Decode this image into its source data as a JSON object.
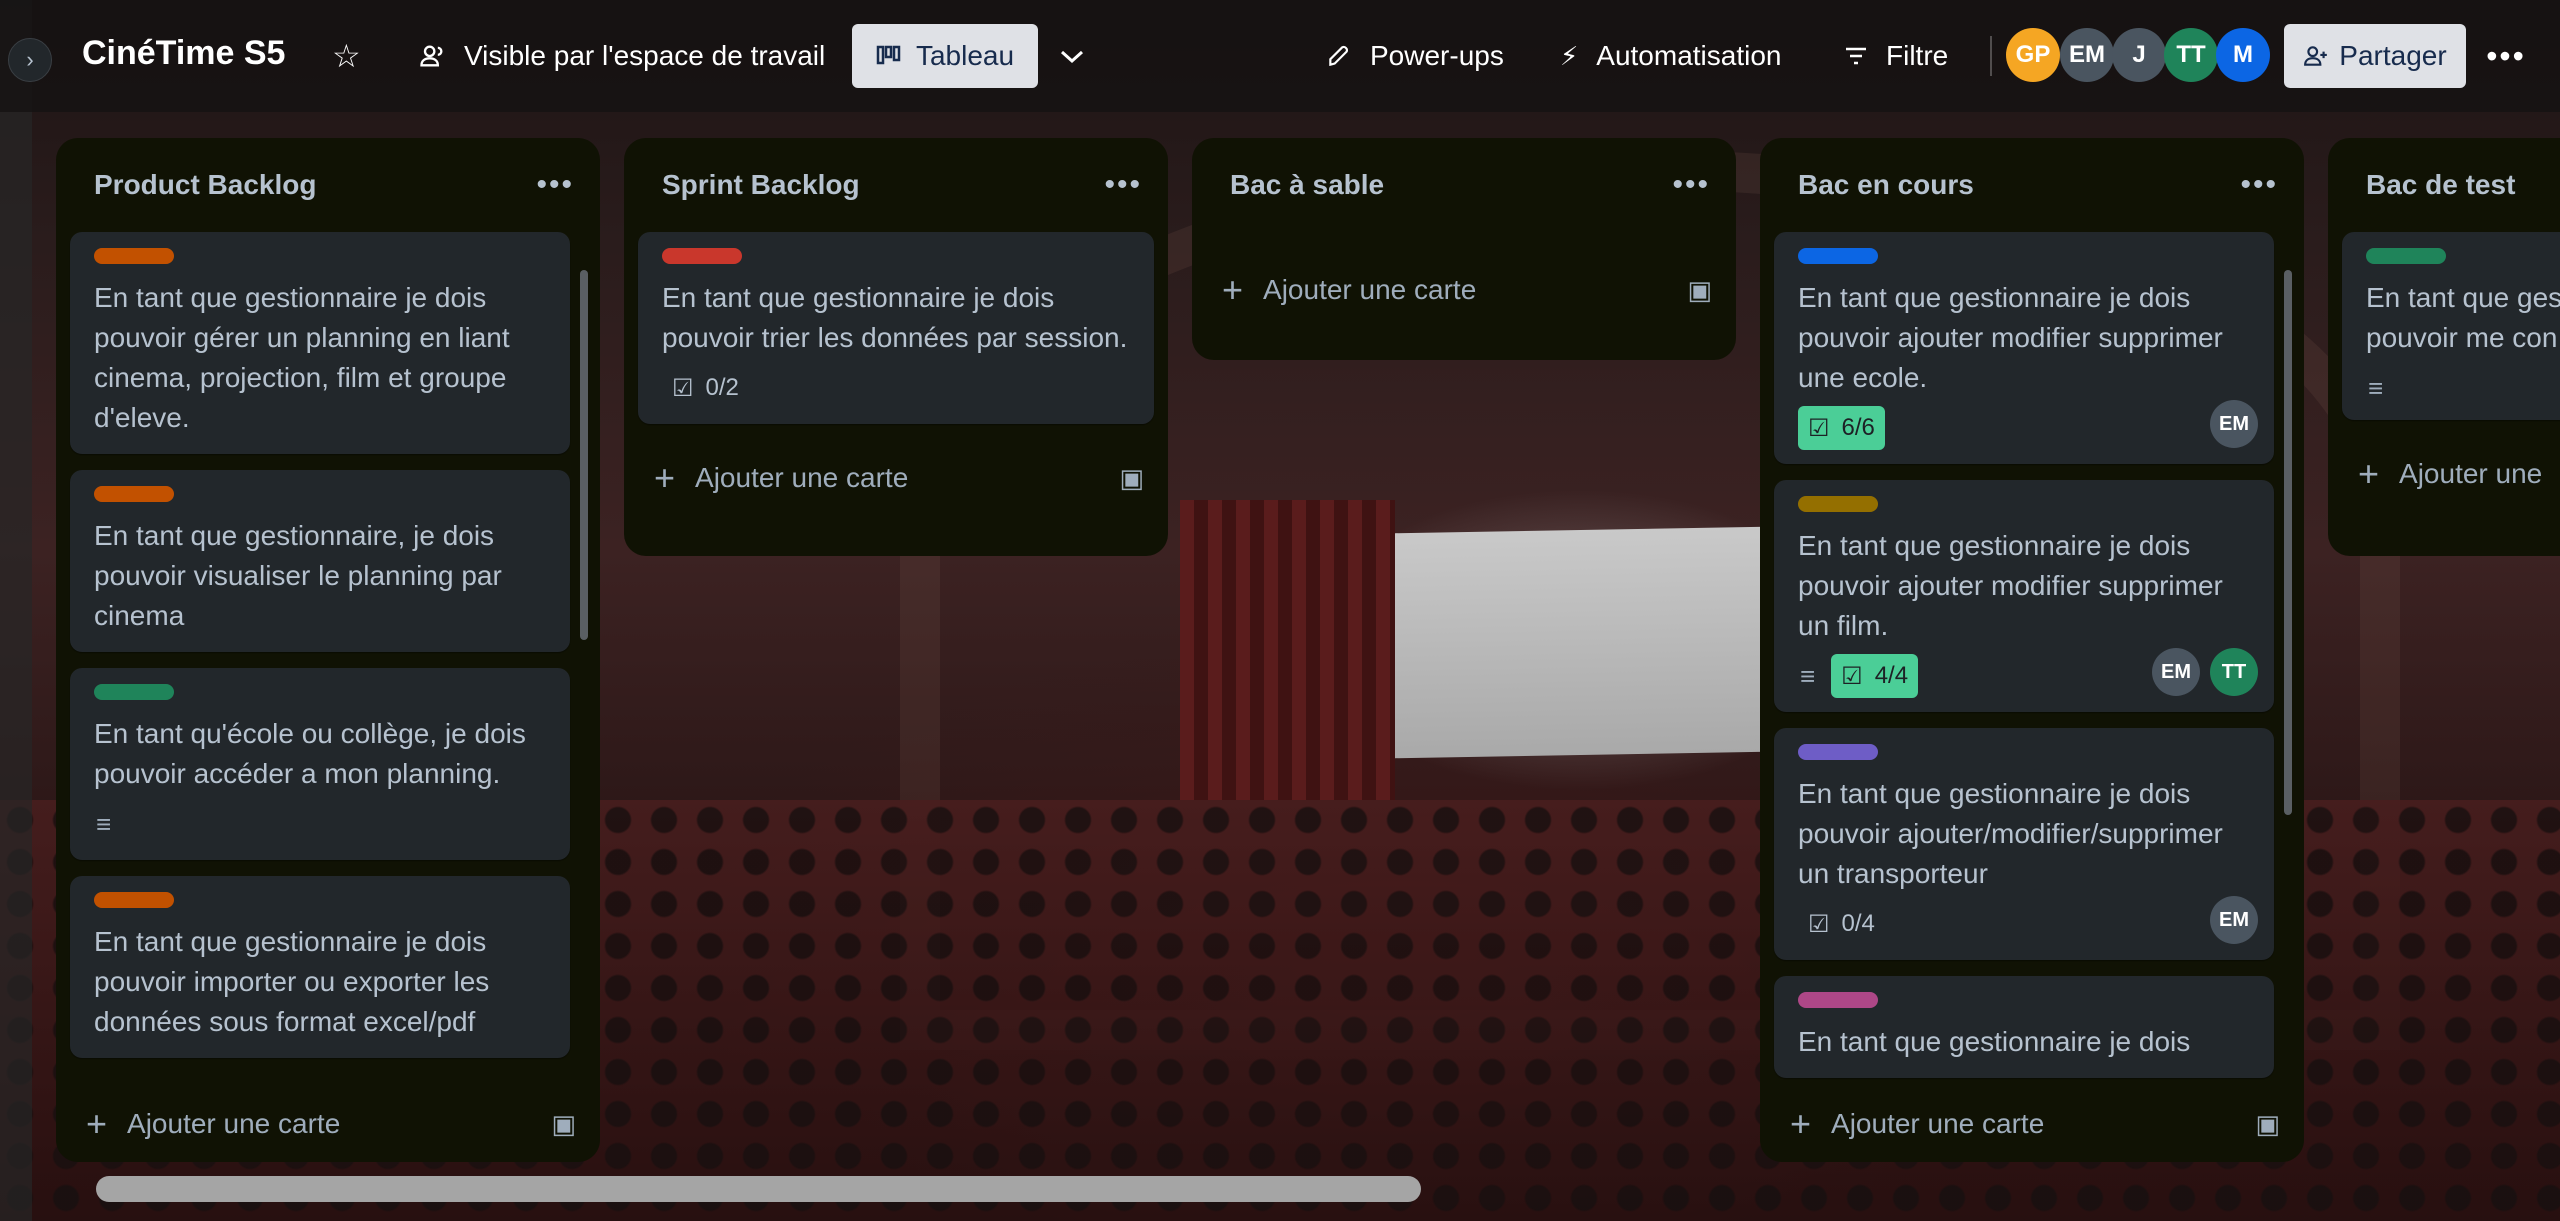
{
  "header": {
    "board_title": "CinéTime S5",
    "visibility_label": "Visible par l'espace de travail",
    "view_label": "Tableau",
    "powerups_label": "Power-ups",
    "automation_label": "Automatisation",
    "filter_label": "Filtre",
    "share_label": "Partager",
    "members": [
      {
        "initials": "GP",
        "color": "#f5a623"
      },
      {
        "initials": "EM",
        "color": "#4a5560"
      },
      {
        "initials": "J",
        "color": "#4a5560"
      },
      {
        "initials": "TT",
        "color": "#1f845a"
      },
      {
        "initials": "M",
        "color": "#0c66e4"
      }
    ]
  },
  "lists": [
    {
      "title": "Product Backlog",
      "add_label": "Ajouter une carte",
      "cards": [
        {
          "label_color": "#c25100",
          "title": "En tant que gestionnaire je dois pouvoir gérer un planning en liant cinema, projection, film et groupe d'eleve."
        },
        {
          "label_color": "#c25100",
          "title": "En tant que gestionnaire, je dois pouvoir visualiser le planning par cinema"
        },
        {
          "label_color": "#1f845a",
          "title": "En tant qu'école ou collège, je dois pouvoir accéder a mon planning."
        },
        {
          "label_color": "#c25100",
          "title": "En tant que gestionnaire je dois pouvoir importer ou exporter les données sous format excel/pdf"
        }
      ]
    },
    {
      "title": "Sprint Backlog",
      "add_label": "Ajouter une carte",
      "cards": [
        {
          "label_color": "#c9372c",
          "title": "En tant que gestionnaire je dois pouvoir trier les données par session.",
          "checklist": "0/2"
        }
      ]
    },
    {
      "title": "Bac à sable",
      "add_label": "Ajouter une carte",
      "cards": []
    },
    {
      "title": "Bac en cours",
      "add_label": "Ajouter une carte",
      "cards": [
        {
          "label_color": "#0c66e4",
          "title": "En tant que gestionnaire je dois pouvoir ajouter modifier supprimer une ecole.",
          "checklist": "6/6",
          "members": [
            "EM"
          ]
        },
        {
          "label_color": "#946f00",
          "title": "En tant que gestionnaire je dois pouvoir ajouter modifier supprimer un film.",
          "checklist": "4/4",
          "members": [
            "EM",
            "TT"
          ]
        },
        {
          "label_color": "#6e5dc6",
          "title": "En tant que gestionnaire je dois pouvoir ajouter/modifier/supprimer un transporteur",
          "checklist": "0/4",
          "members": [
            "EM"
          ]
        },
        {
          "label_color": "#ae4787",
          "title": "En tant que gestionnaire je dois"
        }
      ]
    },
    {
      "title": "Bac de test",
      "add_label": "Ajouter une",
      "cards": [
        {
          "label_color": "#1f845a",
          "title_line1": "En tant que ges",
          "title_line2": "pouvoir me con"
        }
      ]
    }
  ],
  "icons": {
    "expand": "chevron-right-icon",
    "star": "star-icon",
    "visibility": "people-icon",
    "view": "board-icon",
    "chevron": "chevron-down-icon",
    "powerups": "rocket-icon",
    "automation": "lightning-icon",
    "filter": "filter-icon",
    "share": "add-person-icon",
    "more": "more-icon"
  },
  "colors": {
    "checklist_complete": "#4bce97",
    "list_background": "#101204",
    "card_background": "#22272b"
  }
}
